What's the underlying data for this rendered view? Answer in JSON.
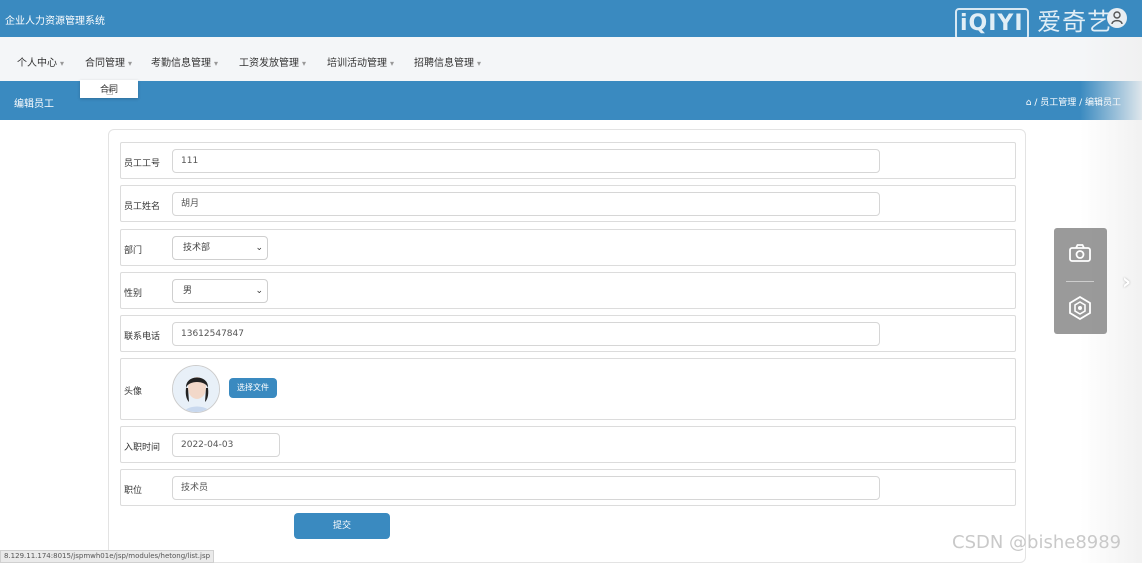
{
  "app": {
    "title": "企业人力资源管理系统",
    "watermark": "iQIYI 爱奇艺"
  },
  "nav": {
    "items": [
      "个人中心",
      "合同管理",
      "考勤信息管理",
      "工资发放管理",
      "培训活动管理",
      "招聘信息管理"
    ],
    "dropdown_item": "合同"
  },
  "page": {
    "title": "编辑员工",
    "breadcrumb": "/ 员工管理 / 编辑员工"
  },
  "form": {
    "employee_no": {
      "label": "员工工号",
      "value": "111"
    },
    "employee_name": {
      "label": "员工姓名",
      "value": "胡月"
    },
    "department": {
      "label": "部门",
      "value": "技术部"
    },
    "gender": {
      "label": "性别",
      "value": "男"
    },
    "phone": {
      "label": "联系电话",
      "value": "13612547847"
    },
    "avatar": {
      "label": "头像",
      "button": "选择文件"
    },
    "hire_date": {
      "label": "入职时间",
      "value": "2022-04-03"
    },
    "position": {
      "label": "职位",
      "value": "技术员"
    },
    "submit": "提交"
  },
  "status_url": "8.129.11.174:8015/jspmwh01e/jsp/modules/hetong/list.jsp",
  "csdn_watermark": "CSDN @bishe8989",
  "colors": {
    "primary": "#3a8ac0",
    "nav_bg": "#f4f6f8"
  }
}
